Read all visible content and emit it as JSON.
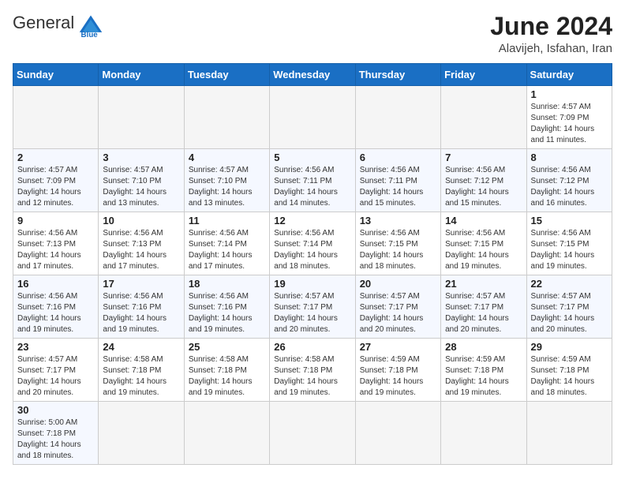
{
  "header": {
    "logo_general": "General",
    "logo_blue": "Blue",
    "month_year": "June 2024",
    "location": "Alavijeh, Isfahan, Iran"
  },
  "weekdays": [
    "Sunday",
    "Monday",
    "Tuesday",
    "Wednesday",
    "Thursday",
    "Friday",
    "Saturday"
  ],
  "weeks": [
    [
      null,
      null,
      null,
      null,
      null,
      null,
      {
        "day": "1",
        "sunrise": "4:57 AM",
        "sunset": "7:09 PM",
        "daylight": "14 hours and 11 minutes."
      }
    ],
    [
      {
        "day": "2",
        "sunrise": "4:57 AM",
        "sunset": "7:09 PM",
        "daylight": "14 hours and 12 minutes."
      },
      {
        "day": "3",
        "sunrise": "4:57 AM",
        "sunset": "7:10 PM",
        "daylight": "14 hours and 13 minutes."
      },
      {
        "day": "4",
        "sunrise": "4:57 AM",
        "sunset": "7:10 PM",
        "daylight": "14 hours and 13 minutes."
      },
      {
        "day": "5",
        "sunrise": "4:56 AM",
        "sunset": "7:11 PM",
        "daylight": "14 hours and 14 minutes."
      },
      {
        "day": "6",
        "sunrise": "4:56 AM",
        "sunset": "7:11 PM",
        "daylight": "14 hours and 15 minutes."
      },
      {
        "day": "7",
        "sunrise": "4:56 AM",
        "sunset": "7:12 PM",
        "daylight": "14 hours and 15 minutes."
      },
      {
        "day": "8",
        "sunrise": "4:56 AM",
        "sunset": "7:12 PM",
        "daylight": "14 hours and 16 minutes."
      }
    ],
    [
      {
        "day": "9",
        "sunrise": "4:56 AM",
        "sunset": "7:13 PM",
        "daylight": "14 hours and 17 minutes."
      },
      {
        "day": "10",
        "sunrise": "4:56 AM",
        "sunset": "7:13 PM",
        "daylight": "14 hours and 17 minutes."
      },
      {
        "day": "11",
        "sunrise": "4:56 AM",
        "sunset": "7:14 PM",
        "daylight": "14 hours and 17 minutes."
      },
      {
        "day": "12",
        "sunrise": "4:56 AM",
        "sunset": "7:14 PM",
        "daylight": "14 hours and 18 minutes."
      },
      {
        "day": "13",
        "sunrise": "4:56 AM",
        "sunset": "7:15 PM",
        "daylight": "14 hours and 18 minutes."
      },
      {
        "day": "14",
        "sunrise": "4:56 AM",
        "sunset": "7:15 PM",
        "daylight": "14 hours and 19 minutes."
      },
      {
        "day": "15",
        "sunrise": "4:56 AM",
        "sunset": "7:15 PM",
        "daylight": "14 hours and 19 minutes."
      }
    ],
    [
      {
        "day": "16",
        "sunrise": "4:56 AM",
        "sunset": "7:16 PM",
        "daylight": "14 hours and 19 minutes."
      },
      {
        "day": "17",
        "sunrise": "4:56 AM",
        "sunset": "7:16 PM",
        "daylight": "14 hours and 19 minutes."
      },
      {
        "day": "18",
        "sunrise": "4:56 AM",
        "sunset": "7:16 PM",
        "daylight": "14 hours and 19 minutes."
      },
      {
        "day": "19",
        "sunrise": "4:57 AM",
        "sunset": "7:17 PM",
        "daylight": "14 hours and 20 minutes."
      },
      {
        "day": "20",
        "sunrise": "4:57 AM",
        "sunset": "7:17 PM",
        "daylight": "14 hours and 20 minutes."
      },
      {
        "day": "21",
        "sunrise": "4:57 AM",
        "sunset": "7:17 PM",
        "daylight": "14 hours and 20 minutes."
      },
      {
        "day": "22",
        "sunrise": "4:57 AM",
        "sunset": "7:17 PM",
        "daylight": "14 hours and 20 minutes."
      }
    ],
    [
      {
        "day": "23",
        "sunrise": "4:57 AM",
        "sunset": "7:17 PM",
        "daylight": "14 hours and 20 minutes."
      },
      {
        "day": "24",
        "sunrise": "4:58 AM",
        "sunset": "7:18 PM",
        "daylight": "14 hours and 19 minutes."
      },
      {
        "day": "25",
        "sunrise": "4:58 AM",
        "sunset": "7:18 PM",
        "daylight": "14 hours and 19 minutes."
      },
      {
        "day": "26",
        "sunrise": "4:58 AM",
        "sunset": "7:18 PM",
        "daylight": "14 hours and 19 minutes."
      },
      {
        "day": "27",
        "sunrise": "4:59 AM",
        "sunset": "7:18 PM",
        "daylight": "14 hours and 19 minutes."
      },
      {
        "day": "28",
        "sunrise": "4:59 AM",
        "sunset": "7:18 PM",
        "daylight": "14 hours and 19 minutes."
      },
      {
        "day": "29",
        "sunrise": "4:59 AM",
        "sunset": "7:18 PM",
        "daylight": "14 hours and 18 minutes."
      }
    ],
    [
      {
        "day": "30",
        "sunrise": "5:00 AM",
        "sunset": "7:18 PM",
        "daylight": "14 hours and 18 minutes."
      },
      null,
      null,
      null,
      null,
      null,
      null
    ]
  ],
  "labels": {
    "sunrise": "Sunrise:",
    "sunset": "Sunset:",
    "daylight": "Daylight:"
  }
}
